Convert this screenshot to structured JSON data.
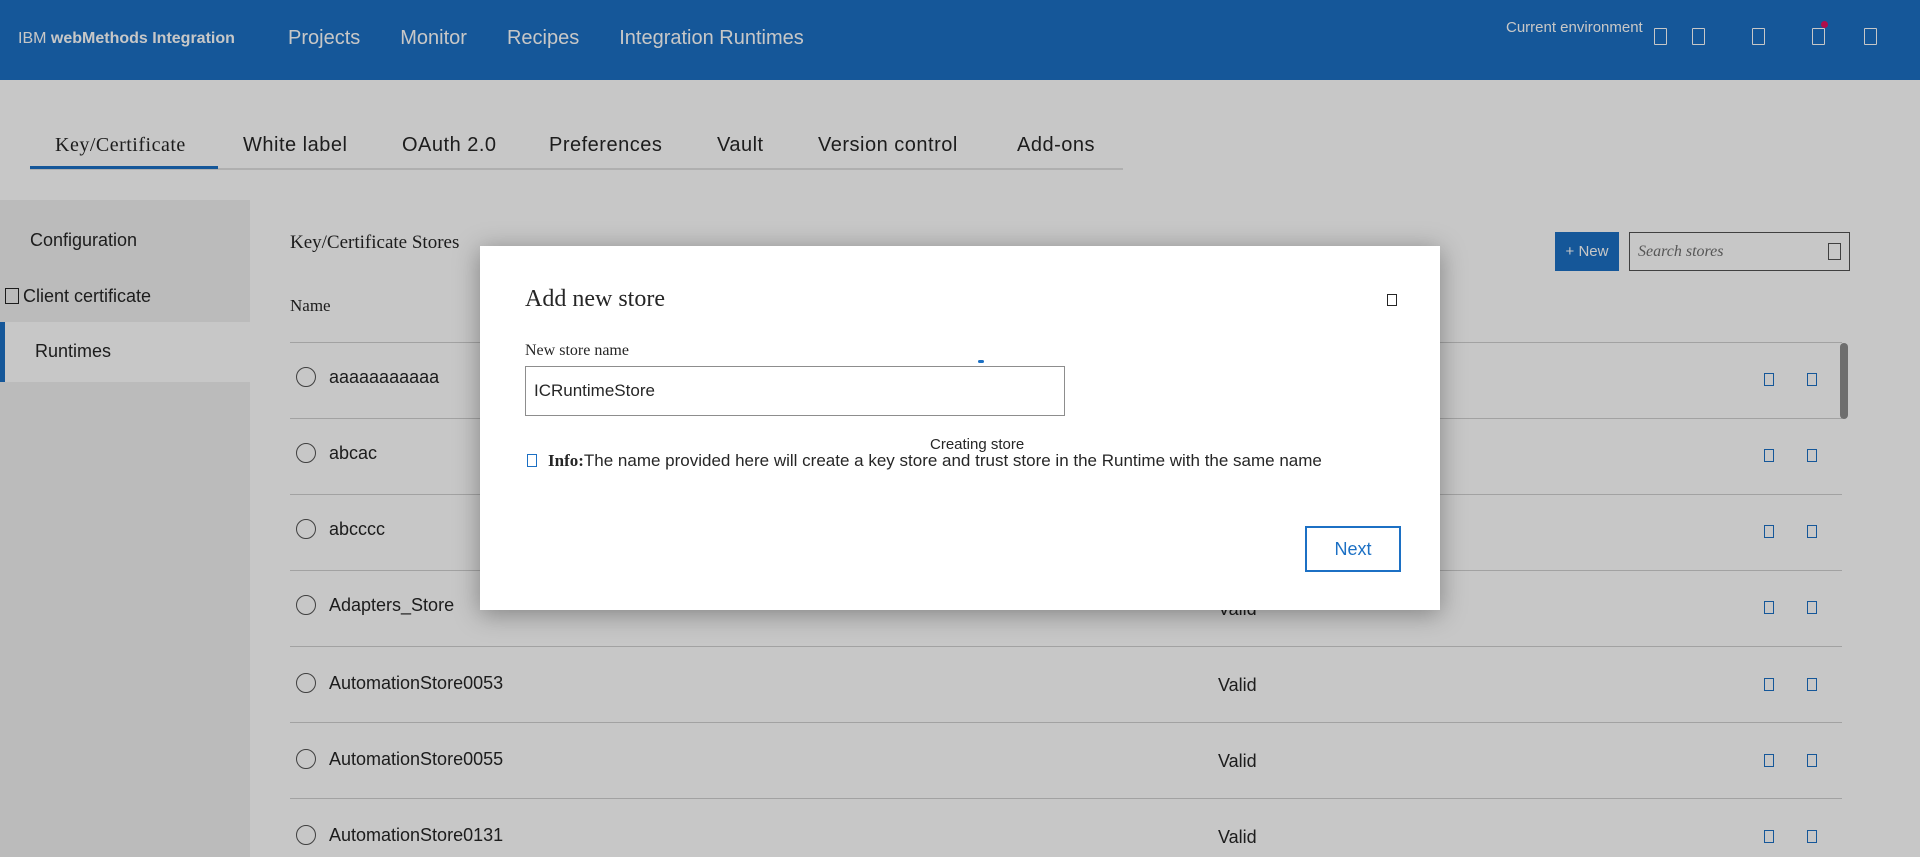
{
  "header": {
    "brand_prefix": "IBM ",
    "brand_name": "webMethods Integration",
    "nav": [
      "Projects",
      "Monitor",
      "Recipes",
      "Integration Runtimes"
    ],
    "env_label": "Current environment"
  },
  "tabs": [
    "Key/Certificate",
    "White label",
    "OAuth 2.0",
    "Preferences",
    "Vault",
    "Version control",
    "Add-ons"
  ],
  "leftnav": {
    "items": [
      "Configuration",
      "Client certificate",
      "Runtimes"
    ]
  },
  "main": {
    "title": "Key/Certificate Stores",
    "col_name": "Name",
    "new_label": "+ New",
    "search_placeholder": "Search stores",
    "rows": [
      {
        "name": "aaaaaaaaaaa",
        "status": ""
      },
      {
        "name": "abcac",
        "status": ""
      },
      {
        "name": "abcccc",
        "status": ""
      },
      {
        "name": "Adapters_Store",
        "status": "Valid"
      },
      {
        "name": "AutomationStore0053",
        "status": "Valid"
      },
      {
        "name": "AutomationStore0055",
        "status": "Valid"
      },
      {
        "name": "AutomationStore0131",
        "status": "Valid"
      }
    ]
  },
  "modal": {
    "title": "Add new store",
    "field_label": "New store name",
    "field_value": "ICRuntimeStore",
    "creating": "Creating store",
    "info_label": "Info:",
    "info_text": "The name provided here will create a key store and trust store in the Runtime with the same name",
    "next_label": "Next"
  },
  "colors": {
    "brand": "#1c70c4",
    "notification": "#e0115f"
  }
}
